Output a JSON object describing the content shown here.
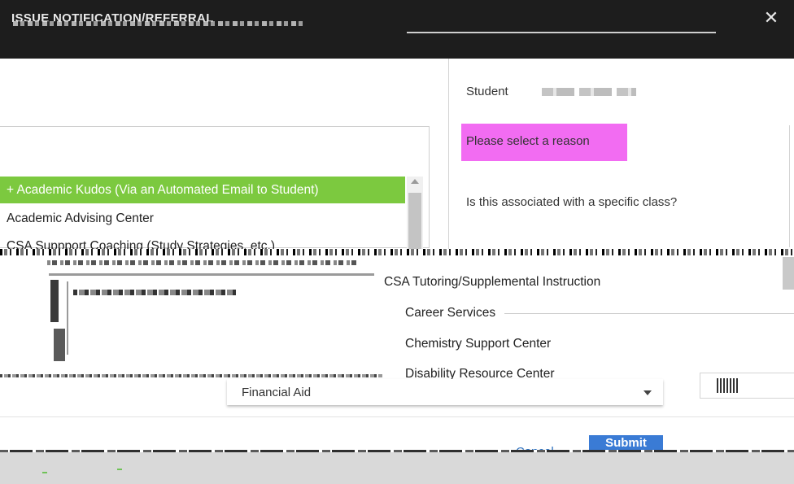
{
  "header": {
    "title": "ISSUE NOTIFICATION/REFERRAL",
    "close_glyph": "✕"
  },
  "student": {
    "label": "Student"
  },
  "reason_prompt": "Please select a reason",
  "class_question": "Is this associated with a specific class?",
  "reasons": {
    "selected": "+ Academic Kudos (Via an Automated Email to Student)",
    "second": "Academic Advising Center",
    "third": "CSA Suppport Coaching (Study Strategies, etc.)"
  },
  "popup_options": [
    "CSA Tutoring/Supplemental Instruction",
    "Career Services",
    "Chemistry Support Center",
    "Disability Resource Center"
  ],
  "select": {
    "value": "Financial Aid"
  },
  "footer": {
    "cancel_label": "Cancel",
    "submit_label": "Submit"
  },
  "colors": {
    "header_bg": "#1d1d1d",
    "reason_highlight": "#f26cf2",
    "selected_item": "#7cc93f",
    "submit_button": "#3a7bd5"
  }
}
